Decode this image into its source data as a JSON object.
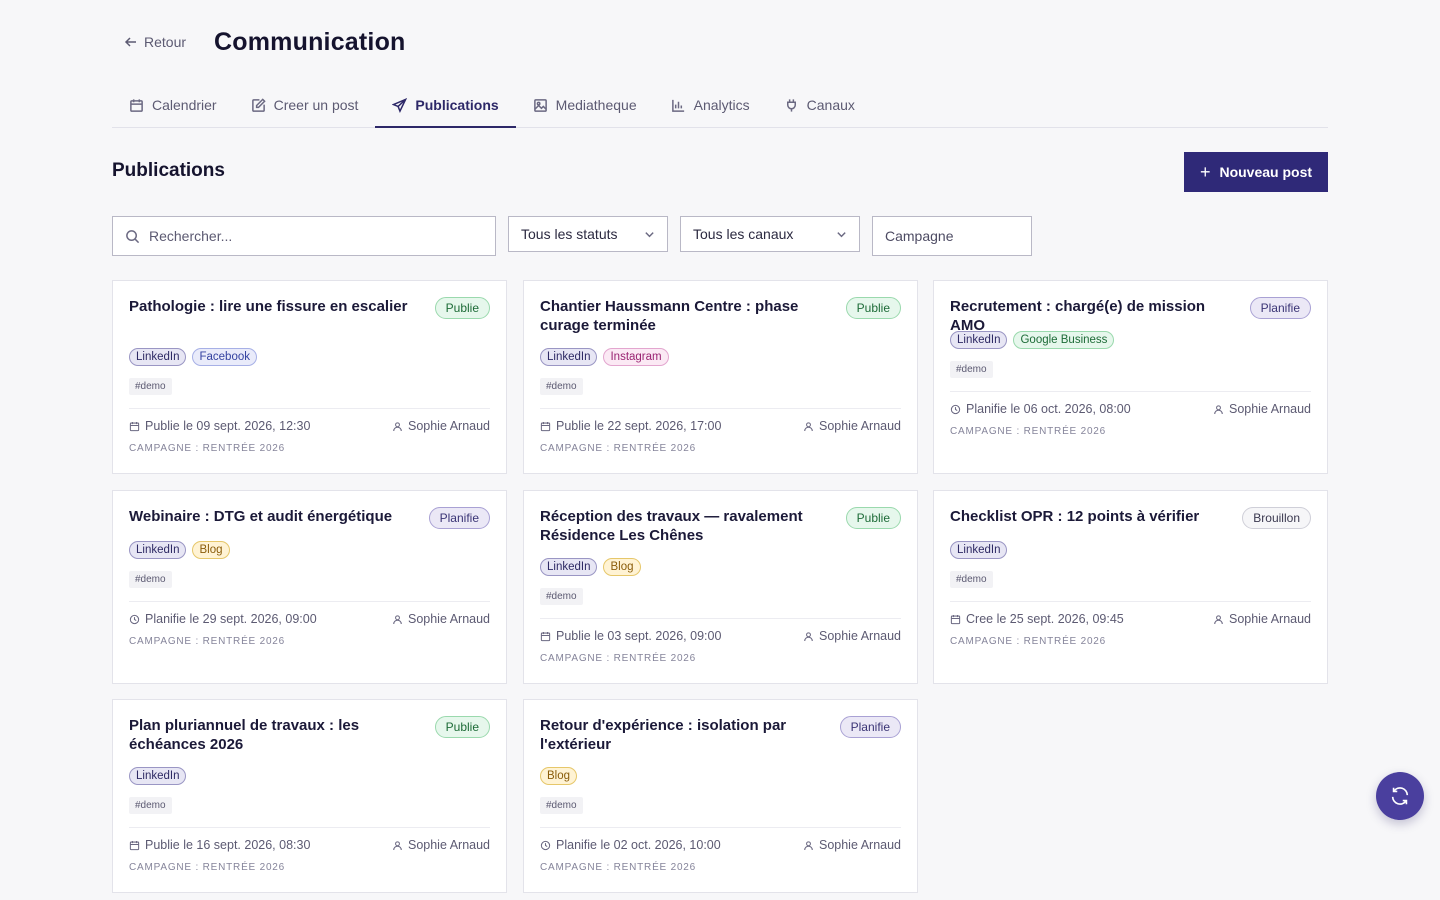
{
  "header": {
    "back_label": "Retour",
    "title": "Communication"
  },
  "tabs": [
    {
      "label": "Calendrier",
      "icon": "calendar-icon"
    },
    {
      "label": "Creer un post",
      "icon": "edit-icon"
    },
    {
      "label": "Publications",
      "icon": "send-icon",
      "active": true
    },
    {
      "label": "Mediatheque",
      "icon": "image-icon"
    },
    {
      "label": "Analytics",
      "icon": "bar-chart-icon"
    },
    {
      "label": "Canaux",
      "icon": "plug-icon"
    }
  ],
  "section": {
    "title": "Publications",
    "new_post_label": "Nouveau post"
  },
  "filters": {
    "search_placeholder": "Rechercher...",
    "status_value": "Tous les statuts",
    "channel_value": "Tous les canaux",
    "campaign_placeholder": "Campagne"
  },
  "posts": [
    {
      "title": "Pathologie : lire une fissure en escalier",
      "status": "Publie",
      "channels": [
        "LinkedIn",
        "Facebook"
      ],
      "tag": "#demo",
      "date_icon": "calendar-icon",
      "date": "Publie le 09 sept. 2026, 12:30",
      "author": "Sophie Arnaud",
      "campaign": "CAMPAGNE : RENTRÉE 2026"
    },
    {
      "title": "Chantier Haussmann Centre : phase curage terminée",
      "status": "Publie",
      "channels": [
        "LinkedIn",
        "Instagram"
      ],
      "tag": "#demo",
      "date_icon": "calendar-icon",
      "date": "Publie le 22 sept. 2026, 17:00",
      "author": "Sophie Arnaud",
      "campaign": "CAMPAGNE : RENTRÉE 2026"
    },
    {
      "title": "Recrutement : chargé(e) de mission AMO",
      "status": "Planifie",
      "channels": [
        "LinkedIn",
        "Google Business"
      ],
      "tag": "#demo",
      "date_icon": "clock-icon",
      "date": "Planifie le 06 oct. 2026, 08:00",
      "author": "Sophie Arnaud",
      "campaign": "CAMPAGNE : RENTRÉE 2026"
    },
    {
      "title": "Webinaire : DTG et audit énergétique",
      "status": "Planifie",
      "channels": [
        "LinkedIn",
        "Blog"
      ],
      "tag": "#demo",
      "date_icon": "clock-icon",
      "date": "Planifie le 29 sept. 2026, 09:00",
      "author": "Sophie Arnaud",
      "campaign": "CAMPAGNE : RENTRÉE 2026"
    },
    {
      "title": "Réception des travaux — ravalement Résidence Les Chênes",
      "status": "Publie",
      "channels": [
        "LinkedIn",
        "Blog"
      ],
      "tag": "#demo",
      "date_icon": "calendar-icon",
      "date": "Publie le 03 sept. 2026, 09:00",
      "author": "Sophie Arnaud",
      "campaign": "CAMPAGNE : RENTRÉE 2026"
    },
    {
      "title": "Checklist OPR : 12 points à vérifier",
      "status": "Brouillon",
      "channels": [
        "LinkedIn"
      ],
      "tag": "#demo",
      "date_icon": "calendar-icon",
      "date": "Cree le 25 sept. 2026, 09:45",
      "author": "Sophie Arnaud",
      "campaign": "CAMPAGNE : RENTRÉE 2026"
    },
    {
      "title": "Plan pluriannuel de travaux : les échéances 2026",
      "status": "Publie",
      "channels": [
        "LinkedIn"
      ],
      "tag": "#demo",
      "date_icon": "calendar-icon",
      "date": "Publie le 16 sept. 2026, 08:30",
      "author": "Sophie Arnaud",
      "campaign": "CAMPAGNE : RENTRÉE 2026"
    },
    {
      "title": "Retour d'expérience : isolation par l'extérieur",
      "status": "Planifie",
      "channels": [
        "Blog"
      ],
      "tag": "#demo",
      "date_icon": "clock-icon",
      "date": "Planifie le 02 oct. 2026, 10:00",
      "author": "Sophie Arnaud",
      "campaign": "CAMPAGNE : RENTRÉE 2026"
    }
  ],
  "fab": {
    "icon": "refresh-icon"
  }
}
